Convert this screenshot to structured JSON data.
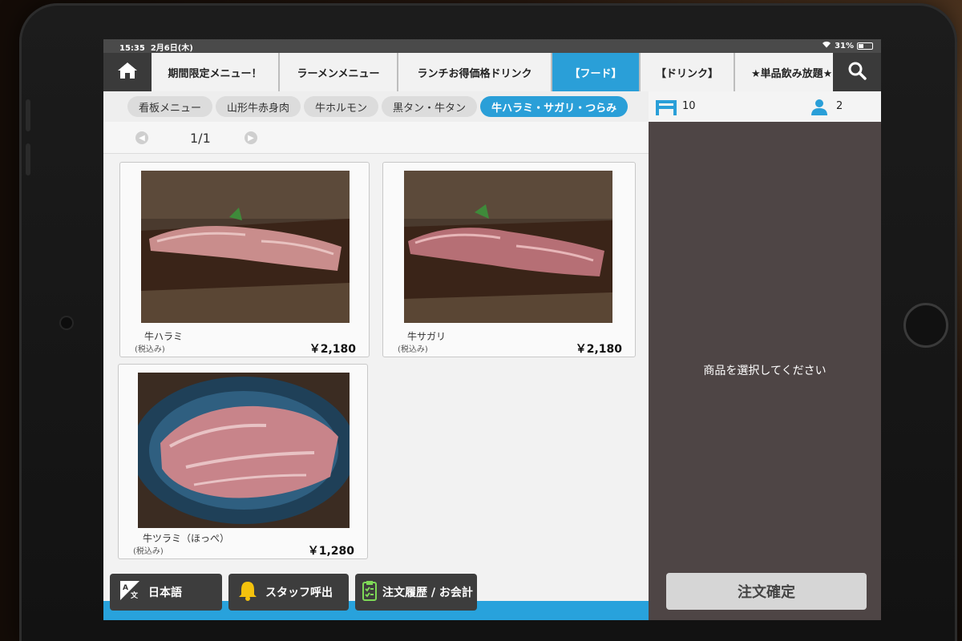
{
  "statusbar": {
    "time": "15:35",
    "date": "2月6日(木)",
    "battery": "31%"
  },
  "tabs": [
    {
      "label": "期間限定メニュー！",
      "active": false
    },
    {
      "label": "ラーメンメニュー",
      "active": false
    },
    {
      "label": "ランチお得価格ドリンク",
      "active": false
    },
    {
      "label": "【フード】",
      "active": true
    },
    {
      "label": "【ドリンク】",
      "active": false
    },
    {
      "label": "★単品飲み放題★",
      "active": false
    }
  ],
  "subcategories": [
    {
      "label": "看板メニュー",
      "active": false
    },
    {
      "label": "山形牛赤身肉",
      "active": false
    },
    {
      "label": "牛ホルモン",
      "active": false
    },
    {
      "label": "黒タン・牛タン",
      "active": false
    },
    {
      "label": "牛ハラミ・サガリ・つらみ",
      "active": true
    }
  ],
  "pager": {
    "label": "1/1"
  },
  "products": [
    {
      "name": "牛ハラミ",
      "tax_note": "(税込み)",
      "price": "￥2,180"
    },
    {
      "name": "牛サガリ",
      "tax_note": "(税込み)",
      "price": "￥2,180"
    },
    {
      "name": "牛ツラミ（ほっぺ）",
      "tax_note": "(税込み)",
      "price": "￥1,280"
    }
  ],
  "order_panel": {
    "table_number": "10",
    "guest_count": "2",
    "empty_message": "商品を選択してください",
    "confirm_label": "注文確定"
  },
  "toolbar": {
    "language_label": "日本語",
    "staff_call_label": "スタッフ呼出",
    "history_label": "注文履歴 / お会計"
  },
  "colors": {
    "accent": "#2a9fd8",
    "panel": "#4e4545",
    "dark_button": "#3d3d3d"
  }
}
